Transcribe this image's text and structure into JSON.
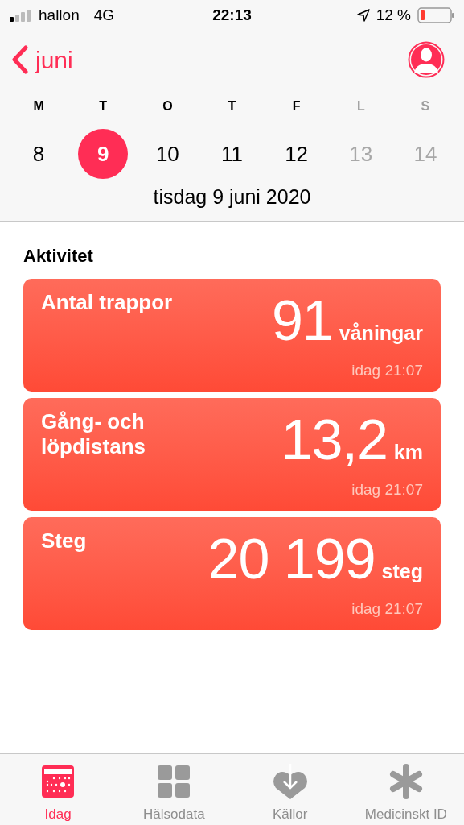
{
  "status_bar": {
    "carrier": "hallon",
    "network": "4G",
    "time": "22:13",
    "battery": "12 %"
  },
  "nav": {
    "back": "juni"
  },
  "week": [
    {
      "letter": "M",
      "date": "8",
      "selected": false,
      "weekend": false
    },
    {
      "letter": "T",
      "date": "9",
      "selected": true,
      "weekend": false
    },
    {
      "letter": "O",
      "date": "10",
      "selected": false,
      "weekend": false
    },
    {
      "letter": "T",
      "date": "11",
      "selected": false,
      "weekend": false
    },
    {
      "letter": "F",
      "date": "12",
      "selected": false,
      "weekend": false
    },
    {
      "letter": "L",
      "date": "13",
      "selected": false,
      "weekend": true
    },
    {
      "letter": "S",
      "date": "14",
      "selected": false,
      "weekend": true
    }
  ],
  "date_label": "tisdag 9 juni 2020",
  "section_title": "Aktivitet",
  "cards": [
    {
      "title": "Antal trappor",
      "value": "91",
      "unit": "våningar",
      "time": "idag 21:07"
    },
    {
      "title": "Gång- och löpdistans",
      "value": "13,2",
      "unit": "km",
      "time": "idag 21:07"
    },
    {
      "title": "Steg",
      "value": "20 199",
      "unit": "steg",
      "time": "idag 21:07"
    }
  ],
  "tabs": [
    {
      "kind": "today",
      "label": "Idag",
      "selected": true
    },
    {
      "kind": "data",
      "label": "Hälsodata",
      "selected": false
    },
    {
      "kind": "sources",
      "label": "Källor",
      "selected": false
    },
    {
      "kind": "medical",
      "label": "Medicinskt ID",
      "selected": false
    }
  ]
}
